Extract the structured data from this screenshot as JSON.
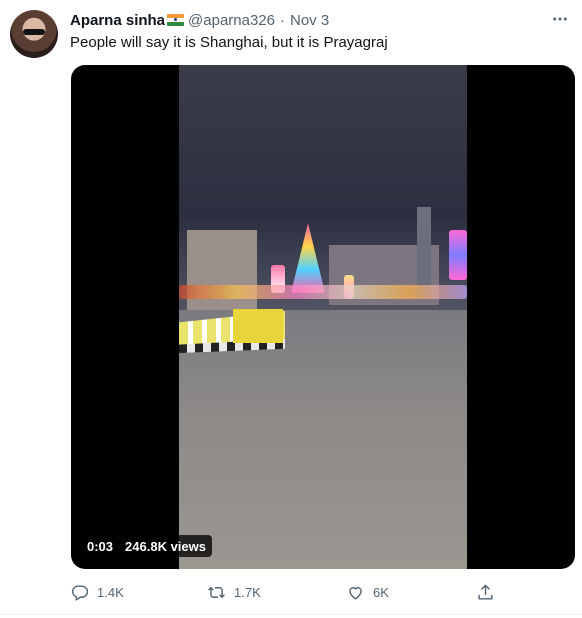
{
  "tweet": {
    "author_name": "Aparna sinha",
    "handle": "@aparna326",
    "separator": "·",
    "date": "Nov 3",
    "text": "People will say it is Shanghai, but it is Prayagraj"
  },
  "video": {
    "time": "0:03",
    "views": "246.8K views"
  },
  "actions": {
    "reply_count": "1.4K",
    "retweet_count": "1.7K",
    "like_count": "6K"
  },
  "icons": {
    "more": "more-horizontal-icon",
    "reply": "reply-icon",
    "retweet": "retweet-icon",
    "like": "heart-icon",
    "share": "share-icon",
    "flag": "india-flag-emoji"
  },
  "colors": {
    "text_primary": "#0f1419",
    "text_secondary": "#536471",
    "media_background": "#000000"
  }
}
